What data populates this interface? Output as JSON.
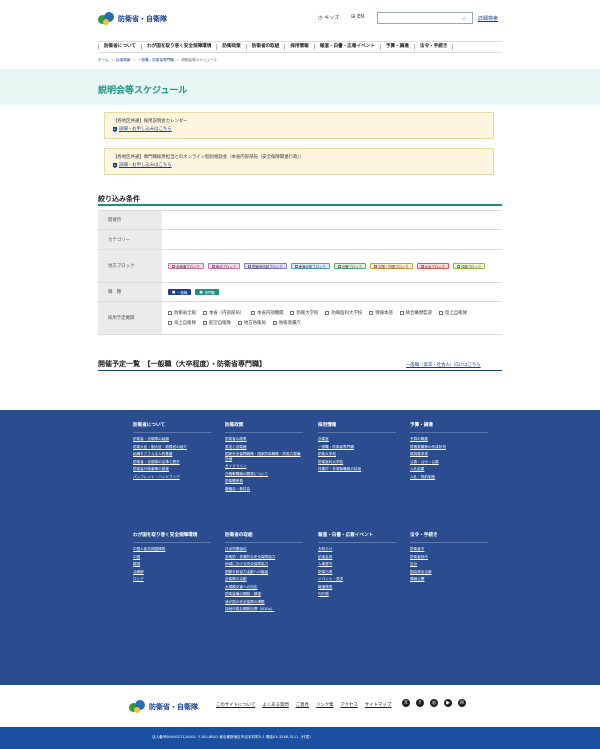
{
  "header": {
    "logo_text": "防衛省・自衛隊",
    "sitemap_label": "キッズ",
    "en_label": "EN",
    "search_placeholder": "",
    "search_link": "詳細検索"
  },
  "gnav": [
    "防衛省について",
    "わが国を取り巻く安全保障環境",
    "防衛政策",
    "防衛省の取組",
    "採用情報",
    "報道・白書・広報イベント",
    "予算・調達",
    "法令・手続き"
  ],
  "breadcrumb": [
    "ホーム",
    "採用情報",
    "一般職・防衛省専門職",
    "説明会等スケジュール"
  ],
  "page_title": "説明会等スケジュール",
  "notices": [
    {
      "title": "【各地区共通】採用説明会カレンダー",
      "link": "詳細・お申し込みはこちら"
    },
    {
      "title": "【各地区共通】専門職採用担当とのオンライン個別相談会（本省内部部局（安全保障関連行政））",
      "link": "詳細・お申し込みはこちら"
    }
  ],
  "filter": {
    "title": "絞り込み条件",
    "rows": {
      "month": "開催月",
      "category": "カテゴリー",
      "block": "地方ブロック",
      "type": "職　種",
      "org": "採用予定機関"
    },
    "blocks": [
      {
        "label": "北海道ブロック",
        "color": "#f7d6e6",
        "border": "#d9739f"
      },
      {
        "label": "東北ブロック",
        "color": "#f6d8ee",
        "border": "#c470b0"
      },
      {
        "label": "関東甲信越ブロック",
        "color": "#e2defa",
        "border": "#8476c9"
      },
      {
        "label": "東海北陸ブロック",
        "color": "#d8ecf8",
        "border": "#5a9cc9"
      },
      {
        "label": "近畿ブロック",
        "color": "#dff3e4",
        "border": "#58ad70"
      },
      {
        "label": "中国・四国ブロック",
        "color": "#fbecd2",
        "border": "#d69a3c"
      },
      {
        "label": "九州ブロック",
        "color": "#fbd9d6",
        "border": "#d45b52"
      },
      {
        "label": "沖縄ブロック",
        "color": "#eef7d4",
        "border": "#94b944"
      }
    ],
    "types": [
      {
        "label": "一般職",
        "color": "#1a3f8c"
      },
      {
        "label": "専門職",
        "color": "#1d9080"
      }
    ],
    "orgs": [
      "防衛省全般",
      "本省（内部部局）",
      "本省内部機関",
      "防衛大学校",
      "防衛医科大学校",
      "情報本部",
      "統合幕僚監部",
      "陸上自衛隊",
      "海上自衛隊",
      "航空自衛隊",
      "地方防衛局",
      "防衛装備庁"
    ]
  },
  "schedule": {
    "title": "開催予定一覧　【一般職（大卒程度）・防衛省専門職】",
    "link": "一般職（高卒・社会人）向けはこちら"
  },
  "footer_cols": [
    {
      "head": "防衛省について",
      "links": [
        "防衛省・自衛隊の組織",
        "防衛大臣・副大臣・政務官の紹介",
        "組織をささえる人的基盤",
        "防衛省・自衛隊の沿革と歴史",
        "防衛省行政事業の推進",
        "パンフレット・ハンドブック"
      ]
    },
    {
      "head": "防衛政策",
      "links": [
        "防衛省の政策",
        "憲法と自衛権",
        "国家安全保障戦略・国家防衛戦略・防衛力整備計画",
        "ガイドライン",
        "次期戦闘機の開発について",
        "防衛関係費",
        "審議会・検討会"
      ]
    },
    {
      "head": "採用情報",
      "links": [
        "自衛官",
        "一般職・防衛省専門職",
        "防衛大学校",
        "防衛医科大学校",
        "任期付・非常勤職員の採用"
      ]
    },
    {
      "head": "予算・調達",
      "links": [
        "予算の概要",
        "財務書類等の作成状況",
        "概算要求書",
        "公表・公示・公募",
        "入札結果",
        "入札・契約制度"
      ]
    },
    {
      "head": "わが国を取り巻く安全保障環境",
      "links": [
        "中国人民共和国情勢",
        "中国",
        "韓国",
        "北朝鮮",
        "ロシア"
      ]
    },
    {
      "head": "防衛省の取組",
      "links": [
        "日米同盟強化",
        "多角的・多層的な安全保障協力",
        "地域における安全保障協力",
        "国際平和協力活動への取組",
        "自衛隊の活動",
        "大規模災害への対応",
        "防衛装備の開発・調達",
        "我が国の安全保障の課題",
        "持続可能な開発目標（SDGs）"
      ]
    },
    {
      "head": "報道・白書・広報イベント",
      "links": [
        "お知らせ",
        "記者会見",
        "人事発令",
        "防衛白書",
        "イベント・見学",
        "報道発表",
        "刊行物"
      ]
    },
    {
      "head": "法令・手続き",
      "links": [
        "防衛省令",
        "防衛省訓令",
        "告示",
        "国会提出法案",
        "情報公開"
      ]
    }
  ],
  "bottom": {
    "logo_text": "防衛省・自衛隊",
    "links": [
      "このサイトについて",
      "よくある質問",
      "ご意見",
      "リンク集",
      "アクセス",
      "サイトマップ"
    ],
    "sns": [
      "X",
      "f",
      "◎",
      "▶",
      "✉"
    ],
    "address": "法人番号8000012120001 〒162-8801 東京都新宿区市谷本村町5-1 電話03-3268-3111（代表）"
  }
}
